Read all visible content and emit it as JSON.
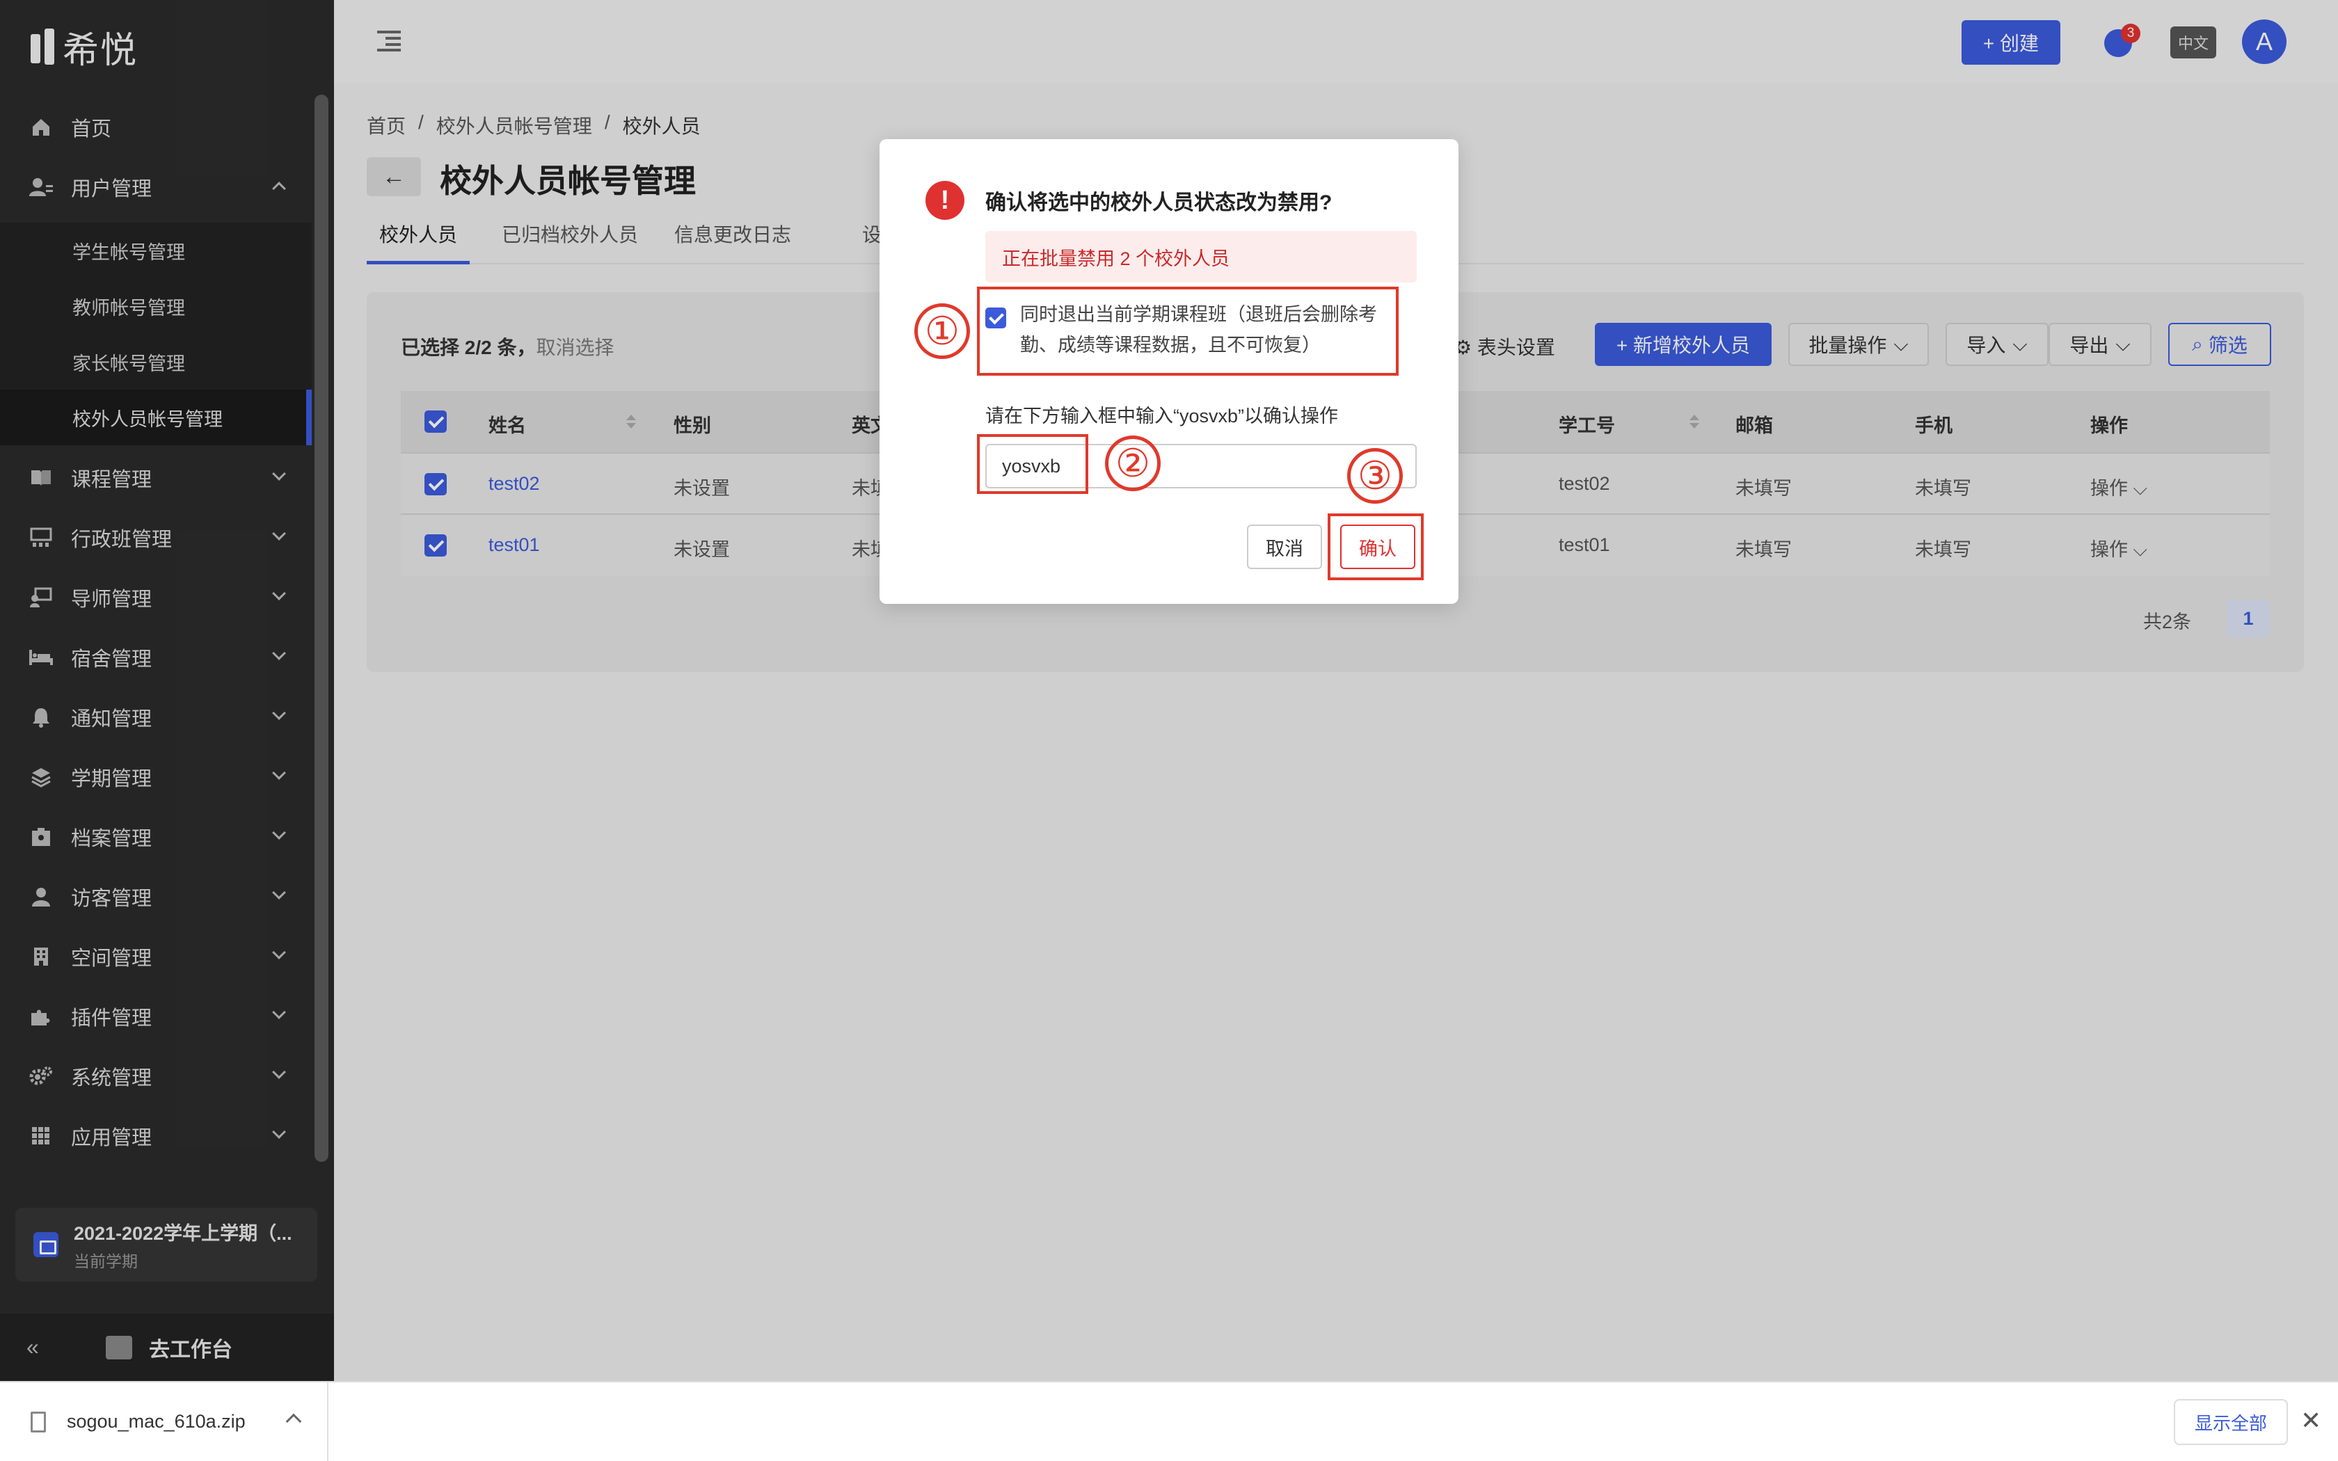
{
  "app": {
    "logo_text": "希悦"
  },
  "sidebar": {
    "items": [
      {
        "label": "首页",
        "icon": "home-icon"
      },
      {
        "label": "用户管理",
        "icon": "user-manage-icon"
      },
      {
        "label": "课程管理",
        "icon": "book-icon"
      },
      {
        "label": "行政班管理",
        "icon": "class-icon"
      },
      {
        "label": "导师管理",
        "icon": "mentor-icon"
      },
      {
        "label": "宿舍管理",
        "icon": "bed-icon"
      },
      {
        "label": "通知管理",
        "icon": "bell-icon"
      },
      {
        "label": "学期管理",
        "icon": "layers-icon"
      },
      {
        "label": "档案管理",
        "icon": "archive-icon"
      },
      {
        "label": "访客管理",
        "icon": "visitor-icon"
      },
      {
        "label": "空间管理",
        "icon": "building-icon"
      },
      {
        "label": "插件管理",
        "icon": "puzzle-icon"
      },
      {
        "label": "系统管理",
        "icon": "gears-icon"
      },
      {
        "label": "应用管理",
        "icon": "grid-icon"
      }
    ],
    "sub_items": [
      "学生帐号管理",
      "教师帐号管理",
      "家长帐号管理",
      "校外人员帐号管理"
    ],
    "term": {
      "title": "2021-2022学年上学期（...",
      "subtitle": "当前学期"
    },
    "collapse": "«",
    "workbench": "去工作台"
  },
  "topbar": {
    "create_label": "+ 创建",
    "notification_count": "3",
    "lang": "中文",
    "avatar": "A"
  },
  "breadcrumb": {
    "home": "首页",
    "sep": "/",
    "parent": "校外人员帐号管理",
    "current": "校外人员"
  },
  "page": {
    "back": "←",
    "title": "校外人员帐号管理"
  },
  "tabs": [
    "校外人员",
    "已归档校外人员",
    "信息更改日志",
    "设"
  ],
  "toolbar": {
    "selected_count": "已选择 2/2 条，",
    "clear_selection": "取消选择",
    "header_settings": "⚙ 表头设置",
    "add_label": "+ 新增校外人员",
    "batch_label": "批量操作",
    "import_label": "导入",
    "export_label": "导出",
    "filter_label": "筛选"
  },
  "table": {
    "columns": [
      "姓名",
      "性别",
      "英文",
      "学工号",
      "邮箱",
      "手机",
      "操作"
    ],
    "rows": [
      {
        "name": "test02",
        "gender": "未设置",
        "english": "未填",
        "id": "test02",
        "email": "未填写",
        "phone": "未填写",
        "action": "操作"
      },
      {
        "name": "test01",
        "gender": "未设置",
        "english": "未填",
        "id": "test01",
        "email": "未填写",
        "phone": "未填写",
        "action": "操作"
      }
    ]
  },
  "pagination": {
    "total": "共2条",
    "page": "1"
  },
  "modal": {
    "title": "确认将选中的校外人员状态改为禁用?",
    "alert": "正在批量禁用 2 个校外人员",
    "option_label": "同时退出当前学期课程班（退班后会删除考勤、成绩等课程数据，且不可恢复）",
    "prompt": "请在下方输入框中输入“yosvxb”以确认操作",
    "input_value": "yosvxb",
    "cancel_label": "取消",
    "confirm_label": "确认"
  },
  "annotations": [
    "①",
    "②",
    "③"
  ],
  "download_bar": {
    "file_name": "sogou_mac_610a.zip",
    "show_all": "显示全部",
    "close": "✕"
  },
  "colors": {
    "accent": "#3b5bdb",
    "danger": "#e03131",
    "annotation": "#e0392b"
  }
}
